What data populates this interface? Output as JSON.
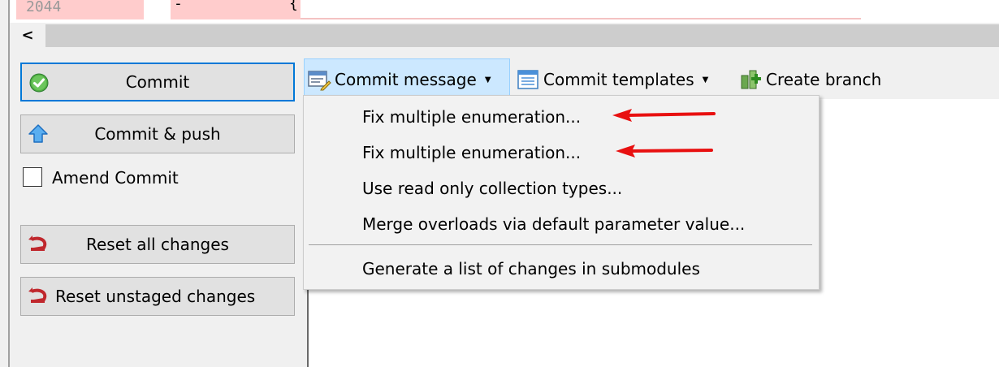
{
  "diff": {
    "line_number": "2044",
    "minus_sign": "-",
    "brace": "{"
  },
  "scrollbar": {
    "left_arrow": "<"
  },
  "buttons": {
    "commit": "Commit",
    "commit_push": "Commit & push",
    "amend_commit": "Amend Commit",
    "reset_all": "Reset all changes",
    "reset_unstaged": "Reset unstaged changes"
  },
  "toolbar": {
    "commit_message": "Commit message",
    "commit_templates": "Commit templates",
    "create_branch": "Create branch"
  },
  "menu": {
    "items": [
      "Fix multiple enumeration...",
      "Fix multiple enumeration...",
      "Use read only collection types...",
      "Merge overloads via default parameter value...",
      "Generate a list of changes in submodules"
    ]
  },
  "colors": {
    "accent": "#0078d7",
    "toolbar_highlight": "#cce8ff",
    "diff_removed": "#ffcccc",
    "annotation_arrow": "#e81010"
  },
  "icons": {
    "commit": "check-circle-icon",
    "commit_push": "up-arrow-icon",
    "reset": "undo-icon",
    "commit_message": "message-edit-icon",
    "commit_templates": "template-icon",
    "create_branch": "branch-icon"
  }
}
